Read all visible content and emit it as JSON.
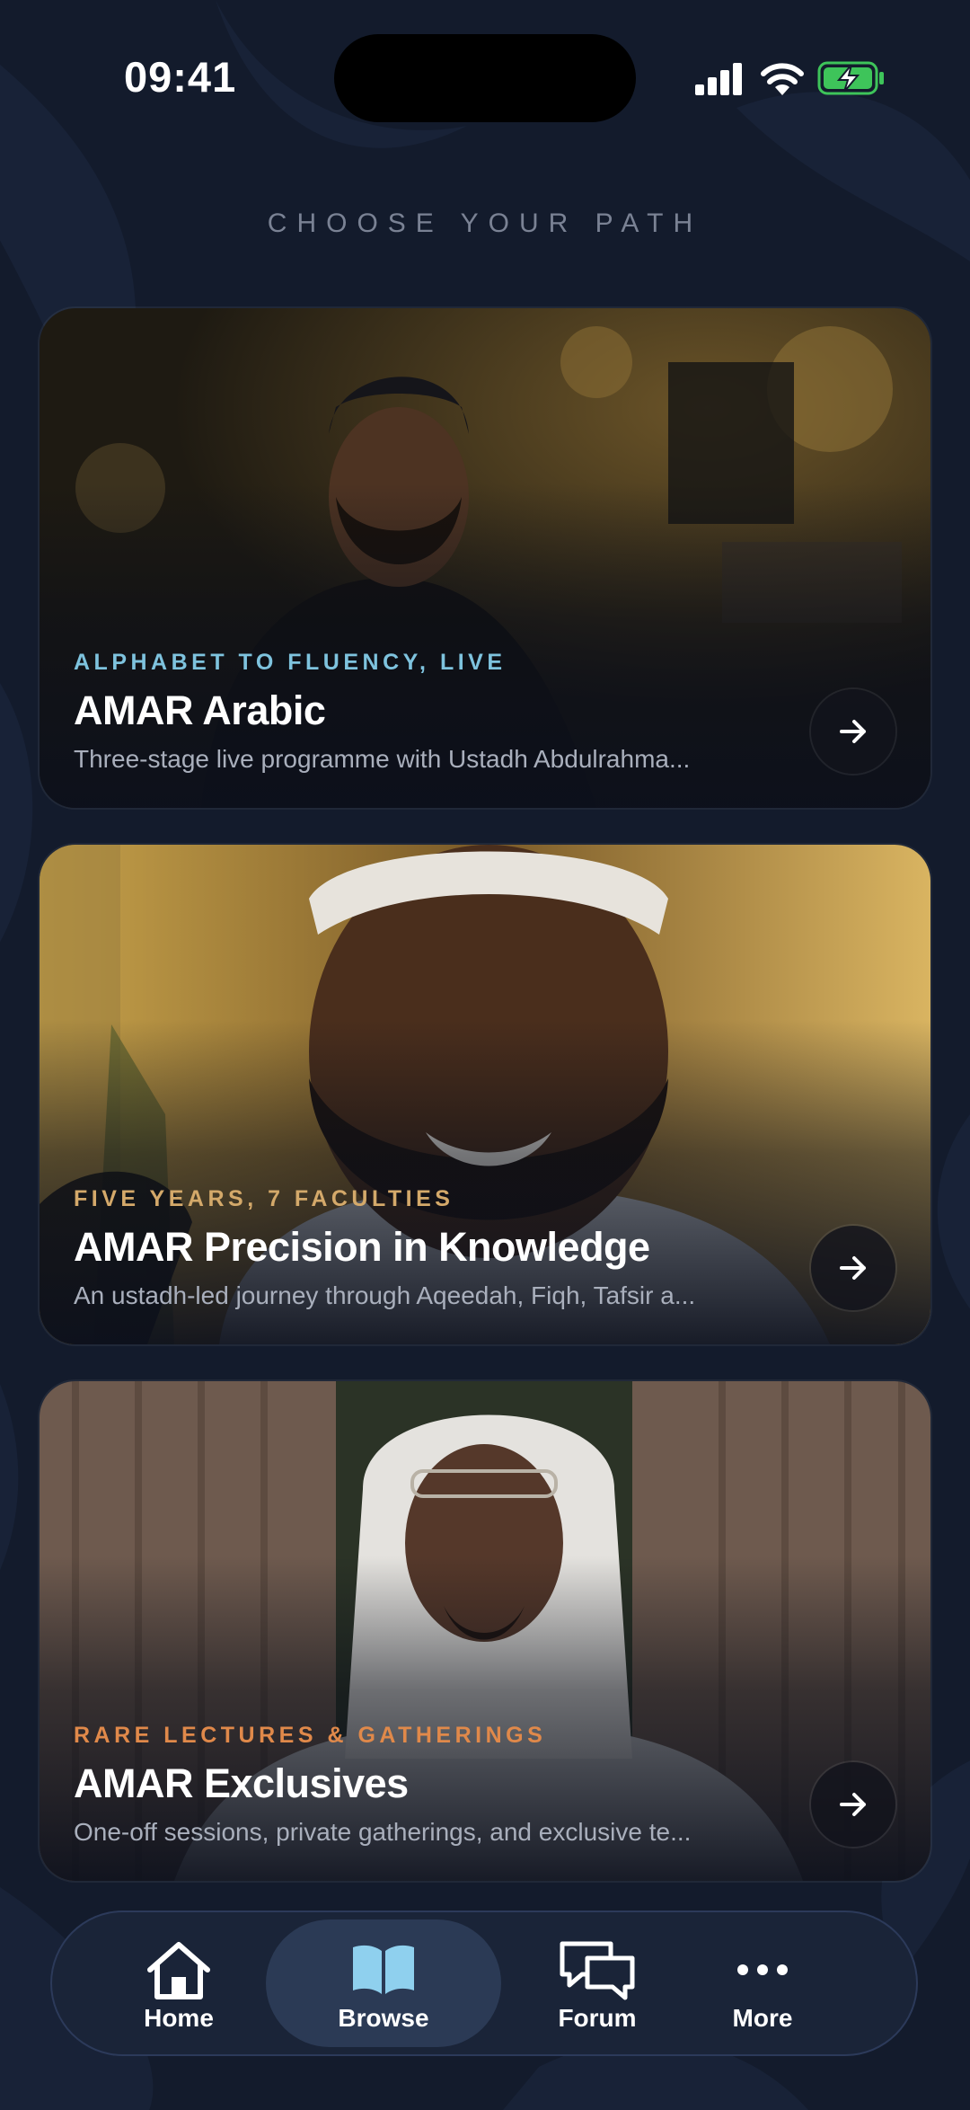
{
  "status_bar": {
    "time": "09:41",
    "icons": [
      "signal-icon",
      "wifi-icon",
      "battery-charging-icon"
    ],
    "battery_color": "#3ec45a"
  },
  "heading": "CHOOSE YOUR PATH",
  "cards": [
    {
      "eyebrow": "ALPHABET TO FLUENCY, LIVE",
      "eyebrow_color": "#7ec3de",
      "title": "AMAR Arabic",
      "description": "Three-stage live programme with Ustadh Abdulrahma...",
      "icon": "arrow-right-icon"
    },
    {
      "eyebrow": "FIVE YEARS, 7 FACULTIES",
      "eyebrow_color": "#d4a96a",
      "title": "AMAR Precision in Knowledge",
      "description": "An ustadh-led journey through Aqeedah, Fiqh, Tafsir a...",
      "icon": "arrow-right-icon"
    },
    {
      "eyebrow": "RARE LECTURES & GATHERINGS",
      "eyebrow_color": "#e0894a",
      "title": "AMAR Exclusives",
      "description": "One-off sessions, private gatherings, and exclusive te...",
      "icon": "arrow-right-icon"
    }
  ],
  "tabbar": {
    "active": "Browse",
    "active_icon_color": "#8fd0ee",
    "tabs": [
      {
        "label": "Home",
        "icon": "home-icon"
      },
      {
        "label": "Browse",
        "icon": "open-book-icon"
      },
      {
        "label": "Forum",
        "icon": "chat-bubbles-icon"
      },
      {
        "label": "More",
        "icon": "more-dots-icon"
      }
    ]
  }
}
